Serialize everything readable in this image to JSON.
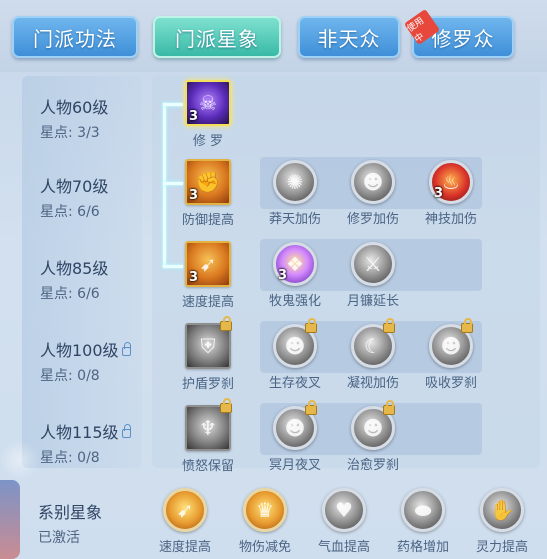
{
  "tabs": [
    {
      "label": "门派功法",
      "active": false
    },
    {
      "label": "门派星象",
      "active": true
    },
    {
      "label": "非天众",
      "active": false
    },
    {
      "label": "修罗众",
      "active": false,
      "badge": "使用中"
    }
  ],
  "rows": [
    {
      "level": "人物60级",
      "points": "星点: 3/3",
      "locked": false
    },
    {
      "level": "人物70级",
      "points": "星点: 6/6",
      "locked": false
    },
    {
      "level": "人物85级",
      "points": "星点: 6/6",
      "locked": false
    },
    {
      "level": "人物100级",
      "points": "星点: 0/8",
      "locked": true
    },
    {
      "level": "人物115级",
      "points": "星点: 0/8",
      "locked": true
    }
  ],
  "nodes": {
    "r0": [
      {
        "label": "修 罗",
        "count": "3",
        "icon": "demon-icon"
      }
    ],
    "r1": [
      {
        "label": "防御提高",
        "count": "3",
        "icon": "arm-icon"
      },
      {
        "label": "莽天加伤",
        "count": "",
        "icon": "storm-icon"
      },
      {
        "label": "修罗加伤",
        "count": "",
        "icon": "demon-face-icon"
      },
      {
        "label": "神技加伤",
        "count": "3",
        "icon": "flame-beast-icon"
      }
    ],
    "r2": [
      {
        "label": "速度提高",
        "count": "3",
        "icon": "speed-icon"
      },
      {
        "label": "牧鬼强化",
        "count": "3",
        "icon": "chest-icon"
      },
      {
        "label": "月镰延长",
        "count": "",
        "icon": "blade-icon"
      }
    ],
    "r3": [
      {
        "label": "护盾罗刹",
        "icon": "shield-beast-icon"
      },
      {
        "label": "生存夜叉",
        "icon": "yaksha-icon"
      },
      {
        "label": "凝视加伤",
        "icon": "crescent-icon"
      },
      {
        "label": "吸收罗刹",
        "icon": "absorb-icon"
      }
    ],
    "r4": [
      {
        "label": "愤怒保留",
        "icon": "rage-icon"
      },
      {
        "label": "冥月夜叉",
        "icon": "yaksha-icon"
      },
      {
        "label": "治愈罗刹",
        "icon": "heal-beast-icon"
      }
    ]
  },
  "series": {
    "title": "系别星象",
    "status": "已激活",
    "items": [
      {
        "label": "速度提高",
        "icon": "speed-icon"
      },
      {
        "label": "物伤减免",
        "icon": "guard-icon"
      },
      {
        "label": "气血提高",
        "icon": "heart-icon"
      },
      {
        "label": "药格增加",
        "icon": "potion-icon"
      },
      {
        "label": "灵力提高",
        "icon": "spirit-icon"
      }
    ]
  }
}
